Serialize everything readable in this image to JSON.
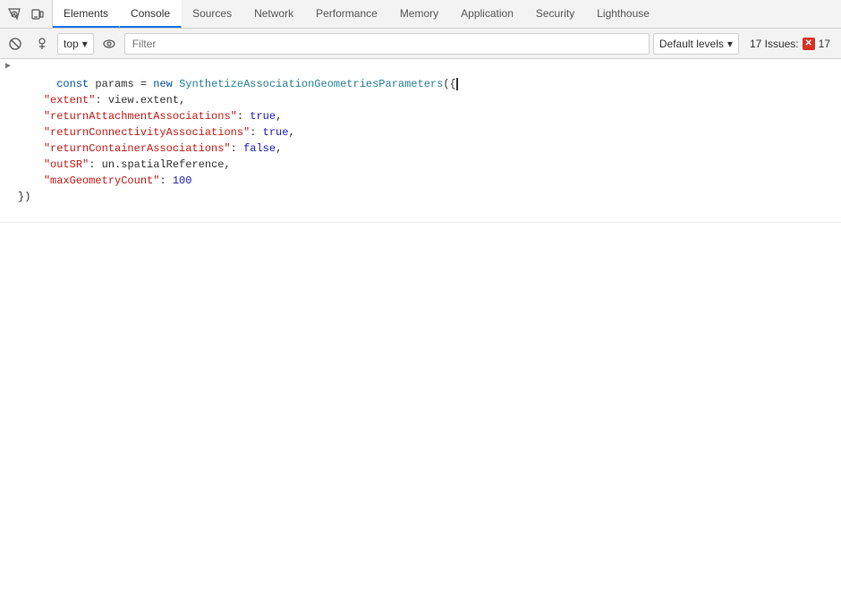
{
  "tabs": [
    {
      "id": "elements",
      "label": "Elements",
      "active": false
    },
    {
      "id": "console",
      "label": "Console",
      "active": true
    },
    {
      "id": "sources",
      "label": "Sources",
      "active": false
    },
    {
      "id": "network",
      "label": "Network",
      "active": false
    },
    {
      "id": "performance",
      "label": "Performance",
      "active": false
    },
    {
      "id": "memory",
      "label": "Memory",
      "active": false
    },
    {
      "id": "application",
      "label": "Application",
      "active": false
    },
    {
      "id": "security",
      "label": "Security",
      "active": false
    },
    {
      "id": "lighthouse",
      "label": "Lighthouse",
      "active": false
    }
  ],
  "toolbar": {
    "context": "top",
    "context_dropdown_label": "▾",
    "filter_placeholder": "Filter",
    "levels_label": "Default levels",
    "levels_dropdown": "▾",
    "issues_label": "17 Issues:",
    "issues_count": "17"
  },
  "console": {
    "entry": {
      "chevron": "▶",
      "line1_keyword": "const",
      "line1_varname": " params ",
      "line1_equals": "=",
      "line1_new": " new ",
      "line1_classname": "SynthetizeAssociationGeometriesParameters",
      "line1_open": "({",
      "line2_prop1": "\"extent\"",
      "line2_colon1": ": view.extent,",
      "line3_prop2": "\"returnAttachmentAssociations\"",
      "line3_colon2": ": true,",
      "line4_prop3": "\"returnConnectivityAssociations\"",
      "line4_colon3": ": true,",
      "line5_prop4": "\"returnContainerAssociations\"",
      "line5_colon4": ": false,",
      "line6_prop5": "\"outSR\"",
      "line6_colon5": ": un.spatialReference,",
      "line7_prop6": "\"maxGeometryCount\"",
      "line7_colon6": ": 100",
      "line8_close": "})"
    }
  }
}
